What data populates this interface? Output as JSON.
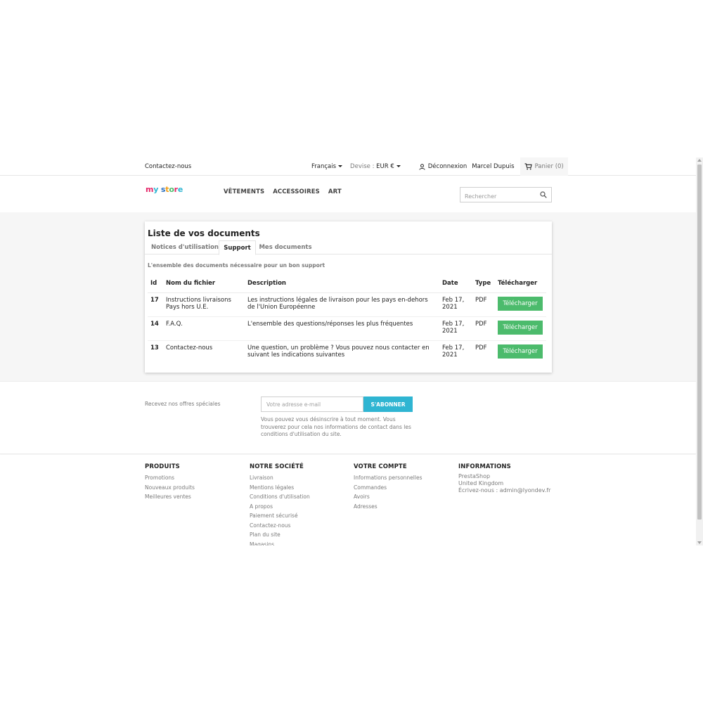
{
  "topnav": {
    "contact": "Contactez-nous",
    "language": "Français",
    "devise_label": "Devise :",
    "devise_value": "EUR €",
    "logout": "Déconnexion",
    "user_name": "Marcel Dupuis",
    "cart": "Panier (0)"
  },
  "header": {
    "logo": "my store",
    "menu": [
      "VÊTEMENTS",
      "ACCESSOIRES",
      "ART"
    ],
    "search_placeholder": "Rechercher"
  },
  "documents": {
    "title": "Liste de vos documents",
    "tabs": [
      "Notices d'utilisation",
      "Support",
      "Mes documents"
    ],
    "active_tab": "Support",
    "subtitle": "L'ensemble des documents nécessaire pour un bon support",
    "columns": [
      "Id",
      "Nom du fichier",
      "Description",
      "Date",
      "Type",
      "Télécharger"
    ],
    "rows": [
      {
        "id": "17",
        "name": "Instructions livraisons Pays hors U.E.",
        "description": "Les instructions légales de livraison pour les pays en-dehors de l'Union Européenne",
        "date": "Feb 17, 2021",
        "type": "PDF",
        "button": "Télécharger"
      },
      {
        "id": "14",
        "name": "F.A.Q.",
        "description": "L'ensemble des questions/réponses les plus fréquentes",
        "date": "Feb 17, 2021",
        "type": "PDF",
        "button": "Télécharger"
      },
      {
        "id": "13",
        "name": "Contactez-nous",
        "description": "Une question, un problème ? Vous pouvez nous contacter en suivant les indications suivantes",
        "date": "Feb 17, 2021",
        "type": "PDF",
        "button": "Télécharger"
      }
    ]
  },
  "newsletter": {
    "label": "Recevez nos offres spéciales",
    "placeholder": "Votre adresse e-mail",
    "button": "S'ABONNER",
    "note": "Vous pouvez vous désinscrire à tout moment. Vous trouverez pour cela nos informations de contact dans les conditions d'utilisation du site."
  },
  "footer": {
    "produits": {
      "title": "PRODUITS",
      "links": [
        "Promotions",
        "Nouveaux produits",
        "Meilleures ventes"
      ]
    },
    "societe": {
      "title": "NOTRE SOCIÉTÉ",
      "links": [
        "Livraison",
        "Mentions légales",
        "Conditions d'utilisation",
        "A propos",
        "Paiement sécurisé",
        "Contactez-nous",
        "Plan du site",
        "Magasins"
      ]
    },
    "compte": {
      "title": "VOTRE COMPTE",
      "links": [
        "Informations personnelles",
        "Commandes",
        "Avoirs",
        "Adresses"
      ]
    },
    "informations": {
      "title": "INFORMATIONS",
      "lines": [
        "PrestaShop",
        "United Kingdom",
        "Écrivez-nous : admin@lyondev.fr"
      ]
    }
  },
  "colors": {
    "accent": "#2fb5d2",
    "download_green": "#4cbb6c",
    "page_grey": "#f6f6f6"
  }
}
